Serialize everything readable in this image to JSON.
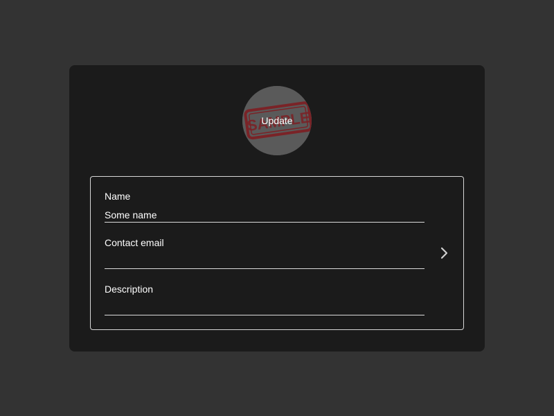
{
  "avatar": {
    "button_label": "Update",
    "stamp_text": "SAMPLE"
  },
  "form": {
    "name": {
      "label": "Name",
      "value": "Some name"
    },
    "contact_email": {
      "label": "Contact email",
      "value": ""
    },
    "description": {
      "label": "Description",
      "value": ""
    },
    "next_icon": "chevron-right-icon"
  },
  "colors": {
    "page_background": "#333333",
    "card_background": "#1b1b1b",
    "stamp_red": "#7a2327"
  }
}
